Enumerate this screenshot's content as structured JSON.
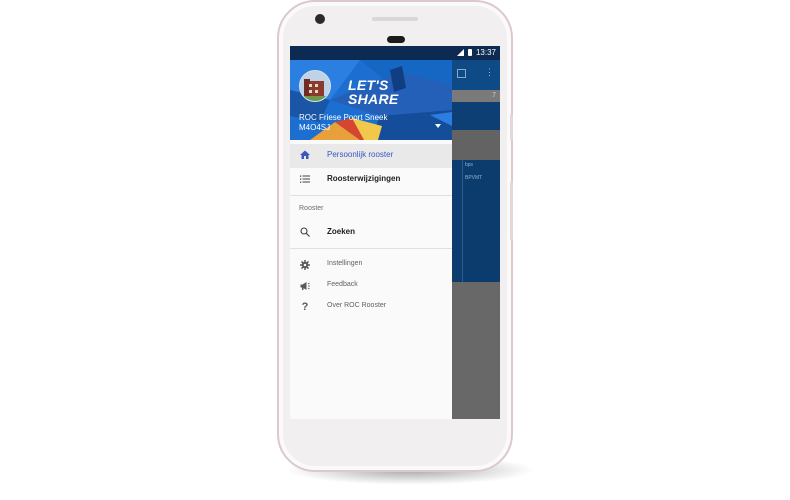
{
  "status_bar": {
    "time": "13:37"
  },
  "drawer": {
    "brand_text": "LET'S SHARE",
    "school_name": "ROC Friese Poort Sneek",
    "class_code": "M4O4SJ",
    "items": [
      {
        "label": "Persoonlijk rooster",
        "icon": "home-icon",
        "active": true
      },
      {
        "label": "Roosterwijzigingen",
        "icon": "list-icon",
        "active": false
      }
    ],
    "section_header": "Rooster",
    "search_label": "Zoeken",
    "secondary_items": [
      {
        "label": "Instellingen",
        "icon": "gear-icon"
      },
      {
        "label": "Feedback",
        "icon": "megaphone-icon"
      },
      {
        "label": "Over ROC Rooster",
        "icon": "question-icon"
      }
    ]
  },
  "background_app": {
    "header_number": "7",
    "cell_line1": "bps",
    "cell_line2": "BPVMT"
  },
  "colors": {
    "accent": "#3a56c5",
    "drawer_header": "#1c6fd0",
    "status_bar": "#0d2b52"
  }
}
